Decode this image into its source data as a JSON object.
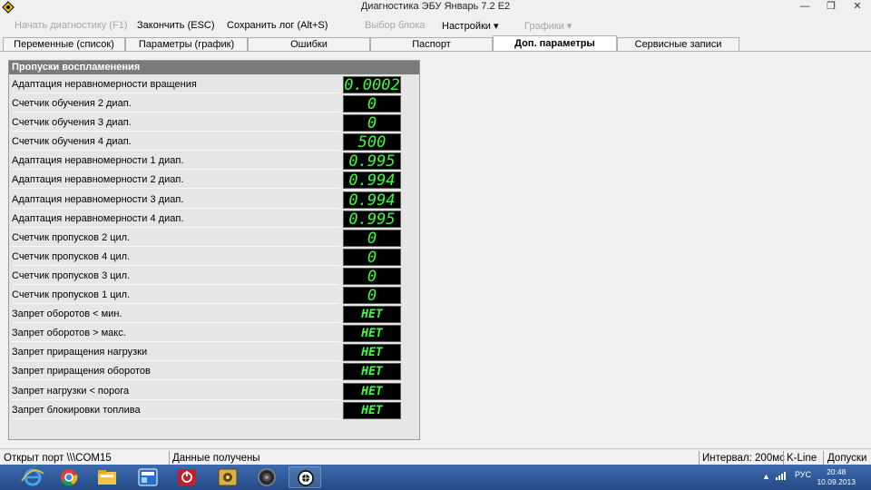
{
  "window": {
    "title": "Диагностика ЭБУ Январь 7.2 Е2",
    "minimize_glyph": "—",
    "restore_glyph": "❐",
    "close_glyph": "✕"
  },
  "menu": {
    "start_diag": "Начать диагностику (F1)",
    "finish": "Закончить (ESC)",
    "save_log": "Сохранить лог (Alt+S)",
    "select_block": "Выбор блока",
    "settings": "Настройки ▾",
    "charts": "Графики ▾"
  },
  "tabs": [
    {
      "label": "Переменные (список)"
    },
    {
      "label": "Параметры (график)"
    },
    {
      "label": "Ошибки"
    },
    {
      "label": "Паспорт"
    },
    {
      "label": "Доп. параметры"
    },
    {
      "label": "Сервисные записи"
    }
  ],
  "panel": {
    "header": "Пропуски воспламенения",
    "rows": [
      {
        "label": "Адаптация неравномерности вращения",
        "value": "0.0002"
      },
      {
        "label": "Счетчик обучения 2 диап.",
        "value": "0"
      },
      {
        "label": "Счетчик обучения 3 диап.",
        "value": "0"
      },
      {
        "label": "Счетчик обучения 4 диап.",
        "value": "500"
      },
      {
        "label": "Адаптация неравномерности 1 диап.",
        "value": "0.995"
      },
      {
        "label": "Адаптация неравномерности 2 диап.",
        "value": "0.994"
      },
      {
        "label": "Адаптация неравномерности 3 диап.",
        "value": "0.994"
      },
      {
        "label": "Адаптация неравномерности 4 диап.",
        "value": "0.995"
      },
      {
        "label": "Счетчик пропусков 2 цил.",
        "value": "0"
      },
      {
        "label": "Счетчик пропусков 4 цил.",
        "value": "0"
      },
      {
        "label": "Счетчик пропусков 3 цил.",
        "value": "0"
      },
      {
        "label": "Счетчик пропусков 1 цил.",
        "value": "0"
      },
      {
        "label": "Запрет оборотов < мин.",
        "value": "НЕТ"
      },
      {
        "label": "Запрет оборотов > макс.",
        "value": "НЕТ"
      },
      {
        "label": "Запрет приращения нагрузки",
        "value": "НЕТ"
      },
      {
        "label": "Запрет приращения оборотов",
        "value": "НЕТ"
      },
      {
        "label": "Запрет нагрузки < порога",
        "value": "НЕТ"
      },
      {
        "label": "Запрет блокировки топлива",
        "value": "НЕТ"
      }
    ]
  },
  "status": {
    "port": "Открыт порт \\\\\\COM15",
    "data": "Данные получены",
    "interval": "Интервал: 200мс",
    "line": "K-Line",
    "tolerances": "Допуски"
  },
  "taskbar": {
    "lang": "РУС",
    "time": "20:48",
    "date": "10.09.2013",
    "icons": [
      "ie-icon",
      "chrome-icon",
      "explorer-icon",
      "app-blue-icon",
      "power-app-icon",
      "tool-app-icon",
      "speaker-app-icon",
      "diag-app-icon"
    ]
  },
  "colors": {
    "display_fg": "#39ff3c",
    "display_bg": "#000000",
    "panel_header_bg": "#7a7a7a",
    "taskbar_bg": "#2a4f8a"
  }
}
